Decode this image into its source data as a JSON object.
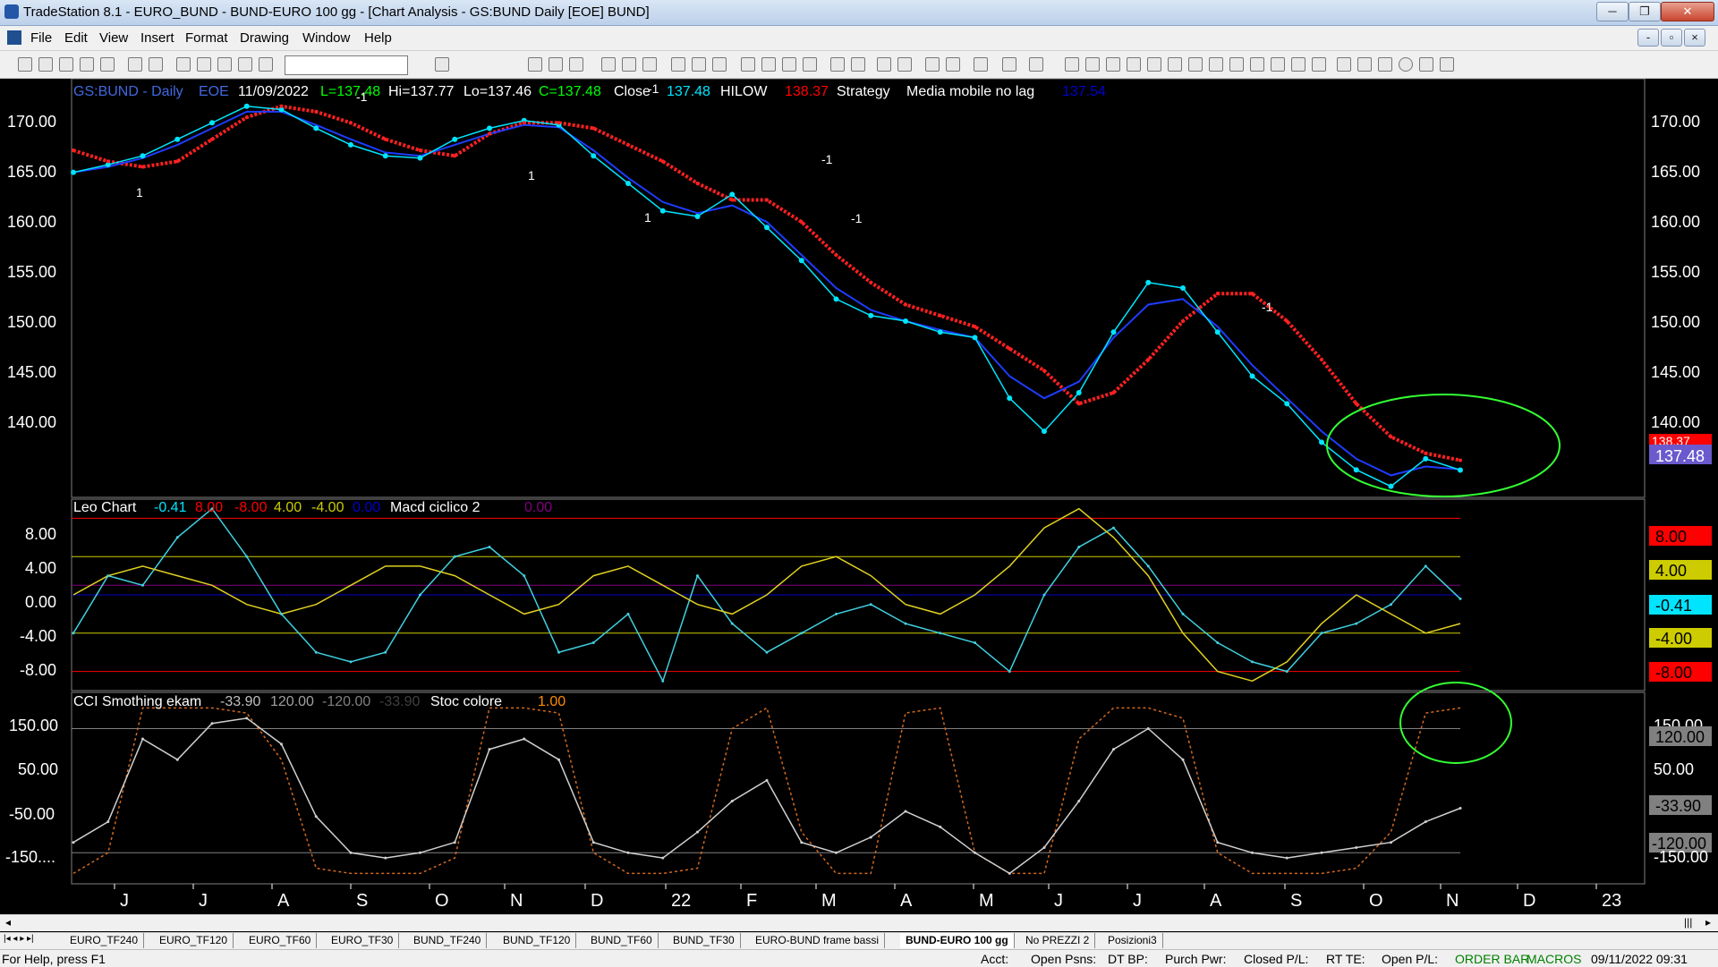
{
  "window": {
    "title": "TradeStation 8.1 - EURO_BUND - BUND-EURO 100 gg - [Chart Analysis - GS:BUND  Daily  [EOE] BUND]",
    "minimize": "─",
    "maximize": "❐",
    "close": "✕",
    "inner_min": "-",
    "inner_max": "▫",
    "inner_close": "×"
  },
  "menu": [
    "File",
    "Edit",
    "View",
    "Insert",
    "Format",
    "Drawing",
    "Window",
    "Help"
  ],
  "toolbar": {
    "symbol_value": ""
  },
  "legend_price": {
    "symbol": "GS:BUND - Daily",
    "session": "EOE",
    "date": "11/09/2022",
    "last": "L=137.48",
    "high": "Hi=137.77",
    "low": "Lo=137.46",
    "close": "C=137.48",
    "close_label": "Close",
    "close_value": "137.48",
    "hilow_label": "HILOW",
    "hilow_value": "138.37",
    "strategy_label": "Strategy",
    "ma_label": "Media mobile no lag",
    "ma_value": "137.54"
  },
  "legend_macd": {
    "name": "Leo Chart",
    "v1": "-0.41",
    "v2": "8.00",
    "v3": "-8.00",
    "v4": "4.00",
    "v5": "-4.00",
    "v6": "0.00",
    "name2": "Macd ciclico 2",
    "v7": "0.00"
  },
  "legend_cci": {
    "name": "CCI Smothing ekam",
    "v1": "-33.90",
    "v2": "120.00",
    "v3": "-120.00",
    "v4": "-33.90",
    "name2": "Stoc colore",
    "v5": "1.00"
  },
  "axis_price": [
    "170.00",
    "165.00",
    "160.00",
    "155.00",
    "150.00",
    "145.00",
    "140.00"
  ],
  "axis_macd": [
    "8.00",
    "4.00",
    "0.00",
    "-4.00",
    "-8.00"
  ],
  "axis_cci_left": [
    "150.00",
    "50.00",
    "-50.00",
    "-150...."
  ],
  "axis_cci_right": [
    "150.00",
    "50.00",
    "-150.00"
  ],
  "right_markers": {
    "price_last": "137.48",
    "price_hilow": "138.37",
    "macd_8": "8.00",
    "macd_4": "4.00",
    "macd_val": "-0.41",
    "macd_m4": "-4.00",
    "macd_m8": "-8.00",
    "cci_120": "120.00",
    "cci_val": "-33.90",
    "cci_m120": "-120.00",
    "colors": {
      "hilow": "#ff0000",
      "last": "#6a5acd",
      "macd8": "#ff0000",
      "macd4": "#cccc00",
      "macdval": "#00e5ff",
      "macdm4": "#cccc00",
      "macdm8": "#ff0000",
      "cci": "#808080"
    }
  },
  "x_axis_months": [
    "J",
    "J",
    "A",
    "S",
    "O",
    "N",
    "D",
    "22",
    "F",
    "M",
    "A",
    "M",
    "J",
    "J",
    "A",
    "S",
    "O",
    "N",
    "D",
    "23"
  ],
  "signal_labels": [
    "1",
    "-1",
    "1",
    "-1",
    "1",
    "-1",
    "-1",
    "-1"
  ],
  "tabs": [
    "EURO_TF240",
    "EURO_TF120",
    "EURO_TF60",
    "EURO_TF30",
    "BUND_TF240",
    "BUND_TF120",
    "BUND_TF60",
    "BUND_TF30",
    "EURO-BUND frame bassi",
    "BUND-EURO 100 gg",
    "No PREZZI 2",
    "Posizioni3"
  ],
  "active_tab": "BUND-EURO 100 gg",
  "status": {
    "help": "For Help, press F1",
    "acct": "Acct:",
    "open_psns": "Open Psns:",
    "dt_bp": "DT BP:",
    "purch_pwr": "Purch Pwr:",
    "closed_pl": "Closed P/L:",
    "rt_te": "RT TE:",
    "open_pl": "Open P/L:",
    "order_bar": "ORDER BAR",
    "macros": "MACROS",
    "datetime": "09/11/2022 09:31"
  },
  "chart_data": [
    {
      "type": "line",
      "title": "GS:BUND - Daily",
      "ylim": [
        135,
        173
      ],
      "series": [
        {
          "name": "Close",
          "values": [
            164.5,
            165.2,
            166.0,
            167.5,
            169.0,
            170.5,
            170.2,
            168.5,
            167.0,
            166.0,
            165.8,
            167.5,
            168.5,
            169.2,
            168.8,
            166.0,
            163.5,
            161.0,
            160.5,
            162.5,
            159.5,
            156.5,
            153.0,
            151.5,
            151.0,
            150.0,
            149.5,
            144.0,
            141.0,
            144.5,
            150.0,
            154.5,
            154.0,
            150.0,
            146.0,
            143.5,
            140.0,
            137.5,
            136.0,
            138.5,
            137.48
          ]
        },
        {
          "name": "HILOW",
          "values": [
            166.5,
            165.5,
            165.0,
            165.5,
            167.5,
            169.5,
            170.5,
            170.0,
            169.0,
            167.5,
            166.5,
            166.0,
            168.0,
            169.0,
            169.0,
            168.5,
            167.0,
            165.5,
            163.5,
            162.0,
            162.0,
            160.0,
            157.0,
            154.5,
            152.5,
            151.5,
            150.5,
            148.5,
            146.5,
            143.5,
            144.5,
            147.5,
            151.0,
            153.5,
            153.5,
            151.0,
            147.5,
            143.5,
            140.5,
            139.0,
            138.37
          ]
        },
        {
          "name": "Media mobile no lag",
          "values": [
            164.5,
            165.0,
            165.8,
            167.0,
            168.5,
            170.0,
            170.0,
            168.8,
            167.5,
            166.3,
            166.0,
            167.0,
            168.0,
            168.8,
            168.6,
            166.5,
            164.0,
            161.8,
            160.8,
            161.5,
            160.0,
            157.0,
            154.0,
            152.0,
            151.0,
            150.2,
            149.5,
            146.0,
            144.0,
            145.5,
            149.5,
            152.5,
            153.0,
            150.5,
            147.0,
            144.0,
            141.0,
            138.5,
            137.0,
            137.8,
            137.54
          ]
        }
      ]
    },
    {
      "type": "line",
      "title": "Leo Chart",
      "ylim": [
        -10,
        10
      ],
      "series": [
        {
          "name": "Leo Chart",
          "values": [
            -4,
            2,
            1,
            6,
            9,
            4,
            -2,
            -6,
            -7,
            -6,
            0,
            4,
            5,
            2,
            -6,
            -5,
            -2,
            -9,
            2,
            -3,
            -6,
            -4,
            -2,
            -1,
            -3,
            -4,
            -5,
            -8,
            0,
            5,
            7,
            3,
            -2,
            -5,
            -7,
            -8,
            -4,
            -3,
            -1,
            3,
            -0.41
          ]
        },
        {
          "name": "Macd ciclico 2",
          "values": [
            0,
            2,
            3,
            2,
            1,
            -1,
            -2,
            -1,
            1,
            3,
            3,
            2,
            0,
            -2,
            -1,
            2,
            3,
            1,
            -1,
            -2,
            0,
            3,
            4,
            2,
            -1,
            -2,
            0,
            3,
            7,
            9,
            6,
            2,
            -4,
            -8,
            -9,
            -7,
            -3,
            0,
            -2,
            -4,
            -3
          ]
        }
      ]
    },
    {
      "type": "line",
      "title": "CCI Smothing ekam",
      "ylim": [
        -180,
        190
      ],
      "series": [
        {
          "name": "CCI Smothing ekam",
          "values": [
            -100,
            -60,
            100,
            60,
            130,
            140,
            90,
            -50,
            -120,
            -130,
            -120,
            -100,
            80,
            100,
            60,
            -100,
            -120,
            -130,
            -80,
            -20,
            20,
            -100,
            -120,
            -90,
            -40,
            -70,
            -120,
            -160,
            -110,
            -20,
            80,
            120,
            60,
            -100,
            -120,
            -130,
            -120,
            -110,
            -100,
            -60,
            -33.9
          ]
        },
        {
          "name": "Stoc colore",
          "values": [
            -160,
            -120,
            160,
            160,
            160,
            150,
            60,
            -150,
            -160,
            -160,
            -160,
            -130,
            160,
            160,
            150,
            -120,
            -160,
            -160,
            -150,
            120,
            160,
            -80,
            -160,
            -160,
            150,
            160,
            -120,
            -160,
            -160,
            100,
            160,
            160,
            140,
            -120,
            -160,
            -160,
            -160,
            -150,
            -80,
            150,
            160
          ]
        }
      ]
    }
  ]
}
